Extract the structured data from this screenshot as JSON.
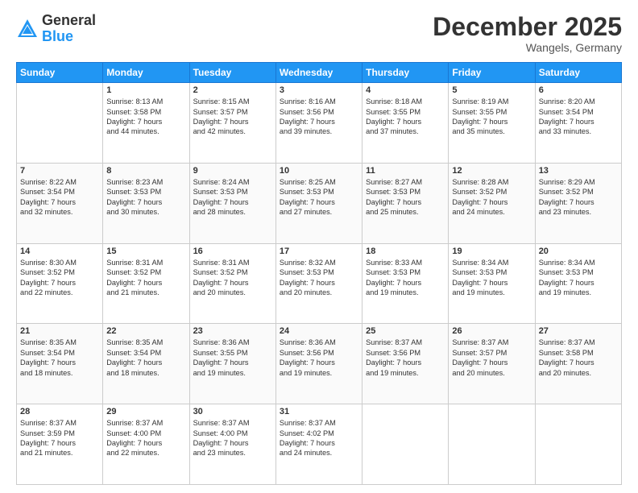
{
  "logo": {
    "general": "General",
    "blue": "Blue"
  },
  "header": {
    "month": "December 2025",
    "location": "Wangels, Germany"
  },
  "days": [
    "Sunday",
    "Monday",
    "Tuesday",
    "Wednesday",
    "Thursday",
    "Friday",
    "Saturday"
  ],
  "weeks": [
    [
      {
        "day": "",
        "content": ""
      },
      {
        "day": "1",
        "content": "Sunrise: 8:13 AM\nSunset: 3:58 PM\nDaylight: 7 hours\nand 44 minutes."
      },
      {
        "day": "2",
        "content": "Sunrise: 8:15 AM\nSunset: 3:57 PM\nDaylight: 7 hours\nand 42 minutes."
      },
      {
        "day": "3",
        "content": "Sunrise: 8:16 AM\nSunset: 3:56 PM\nDaylight: 7 hours\nand 39 minutes."
      },
      {
        "day": "4",
        "content": "Sunrise: 8:18 AM\nSunset: 3:55 PM\nDaylight: 7 hours\nand 37 minutes."
      },
      {
        "day": "5",
        "content": "Sunrise: 8:19 AM\nSunset: 3:55 PM\nDaylight: 7 hours\nand 35 minutes."
      },
      {
        "day": "6",
        "content": "Sunrise: 8:20 AM\nSunset: 3:54 PM\nDaylight: 7 hours\nand 33 minutes."
      }
    ],
    [
      {
        "day": "7",
        "content": "Sunrise: 8:22 AM\nSunset: 3:54 PM\nDaylight: 7 hours\nand 32 minutes."
      },
      {
        "day": "8",
        "content": "Sunrise: 8:23 AM\nSunset: 3:53 PM\nDaylight: 7 hours\nand 30 minutes."
      },
      {
        "day": "9",
        "content": "Sunrise: 8:24 AM\nSunset: 3:53 PM\nDaylight: 7 hours\nand 28 minutes."
      },
      {
        "day": "10",
        "content": "Sunrise: 8:25 AM\nSunset: 3:53 PM\nDaylight: 7 hours\nand 27 minutes."
      },
      {
        "day": "11",
        "content": "Sunrise: 8:27 AM\nSunset: 3:53 PM\nDaylight: 7 hours\nand 25 minutes."
      },
      {
        "day": "12",
        "content": "Sunrise: 8:28 AM\nSunset: 3:52 PM\nDaylight: 7 hours\nand 24 minutes."
      },
      {
        "day": "13",
        "content": "Sunrise: 8:29 AM\nSunset: 3:52 PM\nDaylight: 7 hours\nand 23 minutes."
      }
    ],
    [
      {
        "day": "14",
        "content": "Sunrise: 8:30 AM\nSunset: 3:52 PM\nDaylight: 7 hours\nand 22 minutes."
      },
      {
        "day": "15",
        "content": "Sunrise: 8:31 AM\nSunset: 3:52 PM\nDaylight: 7 hours\nand 21 minutes."
      },
      {
        "day": "16",
        "content": "Sunrise: 8:31 AM\nSunset: 3:52 PM\nDaylight: 7 hours\nand 20 minutes."
      },
      {
        "day": "17",
        "content": "Sunrise: 8:32 AM\nSunset: 3:53 PM\nDaylight: 7 hours\nand 20 minutes."
      },
      {
        "day": "18",
        "content": "Sunrise: 8:33 AM\nSunset: 3:53 PM\nDaylight: 7 hours\nand 19 minutes."
      },
      {
        "day": "19",
        "content": "Sunrise: 8:34 AM\nSunset: 3:53 PM\nDaylight: 7 hours\nand 19 minutes."
      },
      {
        "day": "20",
        "content": "Sunrise: 8:34 AM\nSunset: 3:53 PM\nDaylight: 7 hours\nand 19 minutes."
      }
    ],
    [
      {
        "day": "21",
        "content": "Sunrise: 8:35 AM\nSunset: 3:54 PM\nDaylight: 7 hours\nand 18 minutes."
      },
      {
        "day": "22",
        "content": "Sunrise: 8:35 AM\nSunset: 3:54 PM\nDaylight: 7 hours\nand 18 minutes."
      },
      {
        "day": "23",
        "content": "Sunrise: 8:36 AM\nSunset: 3:55 PM\nDaylight: 7 hours\nand 19 minutes."
      },
      {
        "day": "24",
        "content": "Sunrise: 8:36 AM\nSunset: 3:56 PM\nDaylight: 7 hours\nand 19 minutes."
      },
      {
        "day": "25",
        "content": "Sunrise: 8:37 AM\nSunset: 3:56 PM\nDaylight: 7 hours\nand 19 minutes."
      },
      {
        "day": "26",
        "content": "Sunrise: 8:37 AM\nSunset: 3:57 PM\nDaylight: 7 hours\nand 20 minutes."
      },
      {
        "day": "27",
        "content": "Sunrise: 8:37 AM\nSunset: 3:58 PM\nDaylight: 7 hours\nand 20 minutes."
      }
    ],
    [
      {
        "day": "28",
        "content": "Sunrise: 8:37 AM\nSunset: 3:59 PM\nDaylight: 7 hours\nand 21 minutes."
      },
      {
        "day": "29",
        "content": "Sunrise: 8:37 AM\nSunset: 4:00 PM\nDaylight: 7 hours\nand 22 minutes."
      },
      {
        "day": "30",
        "content": "Sunrise: 8:37 AM\nSunset: 4:00 PM\nDaylight: 7 hours\nand 23 minutes."
      },
      {
        "day": "31",
        "content": "Sunrise: 8:37 AM\nSunset: 4:02 PM\nDaylight: 7 hours\nand 24 minutes."
      },
      {
        "day": "",
        "content": ""
      },
      {
        "day": "",
        "content": ""
      },
      {
        "day": "",
        "content": ""
      }
    ]
  ]
}
